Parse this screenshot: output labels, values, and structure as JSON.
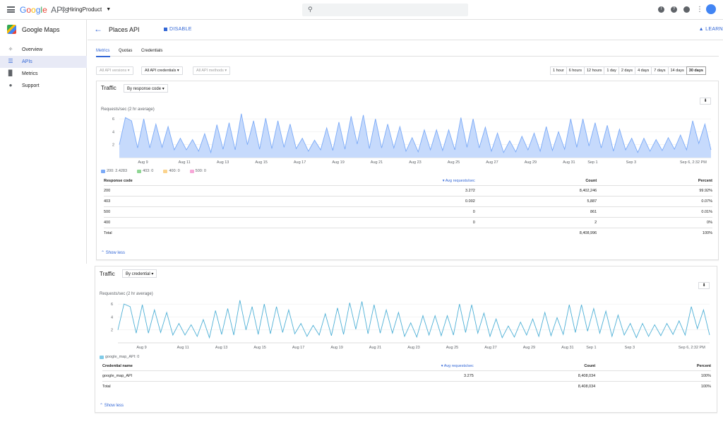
{
  "topbar": {
    "logo": {
      "g1": "G",
      "g2": "o",
      "g3": "o",
      "g4": "g",
      "g5": "l",
      "g6": "e",
      "apis": "APIs"
    },
    "project": "HiringProduct",
    "search_placeholder": ""
  },
  "sidebar": {
    "title": "Google Maps",
    "items": [
      {
        "label": "Overview",
        "icon": "diamond-icon"
      },
      {
        "label": "APIs",
        "icon": "list-icon"
      },
      {
        "label": "Metrics",
        "icon": "bar-chart-icon"
      },
      {
        "label": "Support",
        "icon": "person-icon"
      }
    ]
  },
  "header": {
    "title": "Places API",
    "disable_label": "DISABLE",
    "learn_label": "LEARN"
  },
  "tabs": [
    "Metrics",
    "Quotas",
    "Credentials"
  ],
  "filters": {
    "versions": "All API versions",
    "credentials": "All API credentials",
    "methods": "All API methods"
  },
  "time_ranges": [
    "1 hour",
    "6 hours",
    "12 hours",
    "1 day",
    "2 days",
    "4 days",
    "7 days",
    "14 days",
    "30 days"
  ],
  "selected_range": "30 days",
  "card1": {
    "title": "Traffic",
    "select": "By response code",
    "ylabel": "Requests/sec (2 hr average)",
    "legend": [
      {
        "label": "200: 2.4283",
        "color": "#7baaf7"
      },
      {
        "label": "403: 0",
        "color": "#8fd694"
      },
      {
        "label": "400: 0",
        "color": "#fbd38d"
      },
      {
        "label": "500: 0",
        "color": "#f7a8d8"
      }
    ],
    "table": {
      "headers": [
        "Response code",
        "Avg requests/sec",
        "Count",
        "Percent"
      ],
      "rows": [
        [
          "200",
          "3.272",
          "8,402,246",
          "99.92%"
        ],
        [
          "403",
          "0.002",
          "5,887",
          "0.07%"
        ],
        [
          "500",
          "0",
          "861",
          "0.01%"
        ],
        [
          "400",
          "0",
          "2",
          "0%"
        ],
        [
          "Total",
          "",
          "8,408,996",
          "100%"
        ]
      ]
    },
    "show_less": "Show less"
  },
  "card2": {
    "title": "Traffic",
    "select": "By credential",
    "ylabel": "Requests/sec (2 hr average)",
    "legend": [
      {
        "label": "google_map_API: 0",
        "color": "#80cbe8"
      }
    ],
    "table": {
      "headers": [
        "Credential name",
        "Avg requests/sec",
        "Count",
        "Percent"
      ],
      "rows": [
        [
          "google_map_API",
          "3.275",
          "8,408,034",
          "100%"
        ],
        [
          "Total",
          "",
          "8,408,034",
          "100%"
        ]
      ]
    },
    "show_less": "Show less"
  },
  "chart_data": [
    {
      "type": "area",
      "ylabel": "Requests/sec (2 hr average)",
      "x": [
        "Aug 9",
        "Aug 11",
        "Aug 13",
        "Aug 15",
        "Aug 17",
        "Aug 19",
        "Aug 21",
        "Aug 23",
        "Aug 25",
        "Aug 27",
        "Aug 29",
        "Aug 31",
        "Sep 1",
        "Sep 3",
        "Sep 6, 2:32 PM"
      ],
      "yticks": [
        2,
        4,
        6
      ],
      "ylim": [
        0,
        7
      ],
      "series": [
        {
          "name": "200: 2.4283",
          "color": "#7baaf7",
          "values": [
            2.0,
            6.2,
            5.7,
            1.5,
            6.0,
            1.5,
            5.2,
            1.6,
            4.8,
            1.2,
            3.0,
            1.2,
            2.8,
            1.0,
            3.7,
            0.8,
            5.1,
            1.3,
            5.4,
            1.2,
            6.8,
            2.0,
            5.7,
            1.3,
            6.1,
            1.4,
            5.7,
            1.6,
            5.2,
            1.4,
            3.0,
            1.0,
            2.7,
            1.2,
            4.6,
            1.1,
            5.5,
            1.3,
            6.4,
            2.1,
            6.6,
            1.4,
            6.0,
            1.5,
            5.2,
            1.5,
            4.8,
            1.0,
            3.1,
            0.9,
            4.3,
            1.2,
            4.3,
            1.1,
            4.3,
            1.2,
            6.2,
            1.6,
            6.0,
            1.5,
            4.7,
            1.0,
            3.8,
            0.8,
            2.6,
            0.9,
            3.3,
            1.2,
            3.8,
            1.0,
            4.8,
            1.1,
            4.0,
            1.3,
            6.0,
            1.6,
            6.0,
            1.8,
            5.4,
            1.5,
            5.0,
            1.0,
            4.4,
            1.2,
            3.0,
            0.8,
            3.0,
            1.0,
            2.8,
            1.1,
            3.1,
            1.3,
            3.5,
            1.2,
            5.7,
            2.2,
            5.2,
            1.2
          ]
        }
      ]
    },
    {
      "type": "line",
      "ylabel": "Requests/sec (2 hr average)",
      "x": [
        "Aug 9",
        "Aug 11",
        "Aug 13",
        "Aug 15",
        "Aug 17",
        "Aug 19",
        "Aug 21",
        "Aug 23",
        "Aug 25",
        "Aug 27",
        "Aug 29",
        "Aug 31",
        "Sep 1",
        "Sep 3",
        "Sep 6, 2:32 PM"
      ],
      "yticks": [
        2,
        4,
        6
      ],
      "ylim": [
        0,
        7
      ],
      "series": [
        {
          "name": "google_map_API: 0",
          "color": "#4fb0d6",
          "values": [
            2.0,
            6.0,
            5.6,
            1.5,
            5.9,
            1.5,
            5.1,
            1.6,
            4.7,
            1.2,
            3.0,
            1.2,
            2.8,
            1.0,
            3.6,
            0.8,
            5.0,
            1.3,
            5.3,
            1.2,
            6.6,
            2.0,
            5.6,
            1.3,
            6.0,
            1.4,
            5.6,
            1.6,
            5.1,
            1.4,
            3.0,
            1.0,
            2.7,
            1.2,
            4.5,
            1.1,
            5.4,
            1.3,
            6.2,
            2.1,
            6.4,
            1.4,
            5.9,
            1.5,
            5.1,
            1.5,
            4.7,
            1.0,
            3.1,
            0.9,
            4.2,
            1.2,
            4.2,
            1.1,
            4.2,
            1.2,
            6.0,
            1.6,
            5.9,
            1.5,
            4.6,
            1.0,
            3.7,
            0.8,
            2.6,
            0.9,
            3.2,
            1.2,
            3.7,
            1.0,
            4.7,
            1.1,
            3.9,
            1.3,
            5.9,
            1.6,
            5.9,
            1.8,
            5.3,
            1.5,
            4.9,
            1.0,
            4.3,
            1.2,
            3.0,
            0.8,
            3.0,
            1.0,
            2.8,
            1.1,
            3.0,
            1.3,
            3.4,
            1.2,
            5.6,
            2.2,
            5.1,
            1.2
          ]
        }
      ]
    }
  ]
}
